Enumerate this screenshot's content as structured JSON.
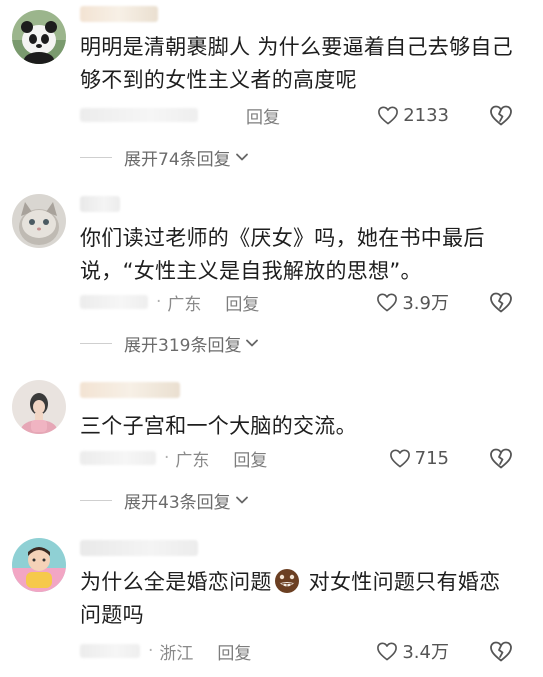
{
  "comments": [
    {
      "text": "明明是清朝裹脚人 为什么要逼着自己去够自己够不到的女性主义者的高度呢",
      "location": "",
      "reply_label": "回复",
      "likes": "2133",
      "expand_label": "展开74条回复"
    },
    {
      "text": "你们读过老师的《厌女》吗，她在书中最后说，“女性主义是自我解放的思想”。",
      "location": "广东",
      "reply_label": "回复",
      "likes": "3.9万",
      "expand_label": "展开319条回复"
    },
    {
      "text": "三个子宫和一个大脑的交流。",
      "location": "广东",
      "reply_label": "回复",
      "likes": "715",
      "expand_label": "展开43条回复"
    },
    {
      "text_before_emoji": "为什么全是婚恋问题",
      "emoji": "grinning-face-emoji",
      "text_after_emoji": " 对女性问题只有婚恋问题吗",
      "location": "浙江",
      "reply_label": "回复",
      "likes": "3.4万"
    }
  ],
  "icons": {
    "like": "heart-outline-icon",
    "dislike": "broken-heart-icon",
    "expand": "chevron-down-icon"
  },
  "colors": {
    "text": "#1e1e1e",
    "meta": "#8d8d8d",
    "icon": "#555555"
  }
}
